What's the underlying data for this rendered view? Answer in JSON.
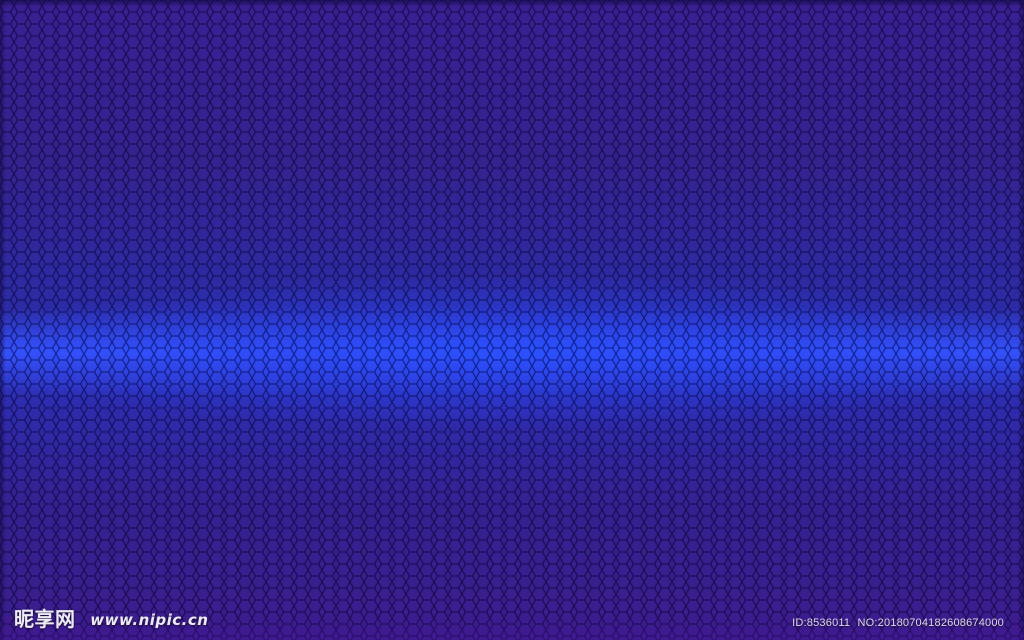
{
  "image": {
    "background_colors": {
      "deep_violet": "#3a1f93",
      "indigo": "#2d2cb0",
      "electric_blue_glow": "#3453ff"
    },
    "watermark": {
      "brand_cn": "昵享网",
      "brand_url": "www.nipic.cn",
      "id_text": "ID:8536011",
      "no_text": "NO:20180704182608674000"
    }
  }
}
